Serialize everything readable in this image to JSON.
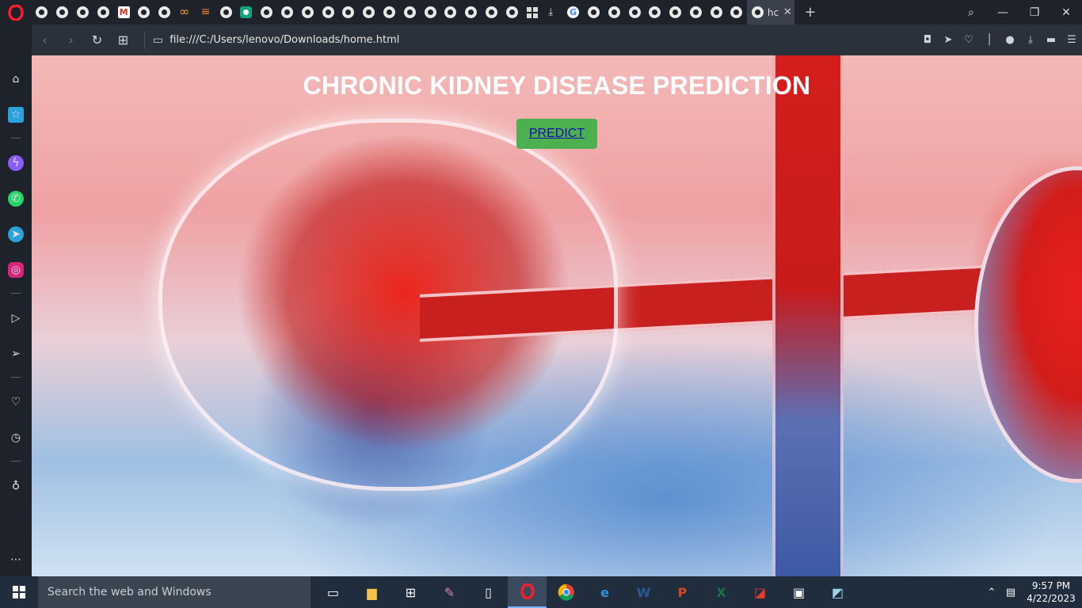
{
  "browser": {
    "active_tab_title": "hc",
    "url": "file:///C:/Users/lenovo/Downloads/home.html"
  },
  "page": {
    "title": "CHRONIC KIDNEY DISEASE PREDICTION",
    "predict_label": "PREDICT"
  },
  "taskbar": {
    "search_placeholder": "Search the web and Windows",
    "time": "9:57 PM",
    "date": "4/22/2023"
  },
  "colors": {
    "predict_button_bg": "#4caf50",
    "link": "#1a0dab",
    "title": "#ffffff"
  }
}
